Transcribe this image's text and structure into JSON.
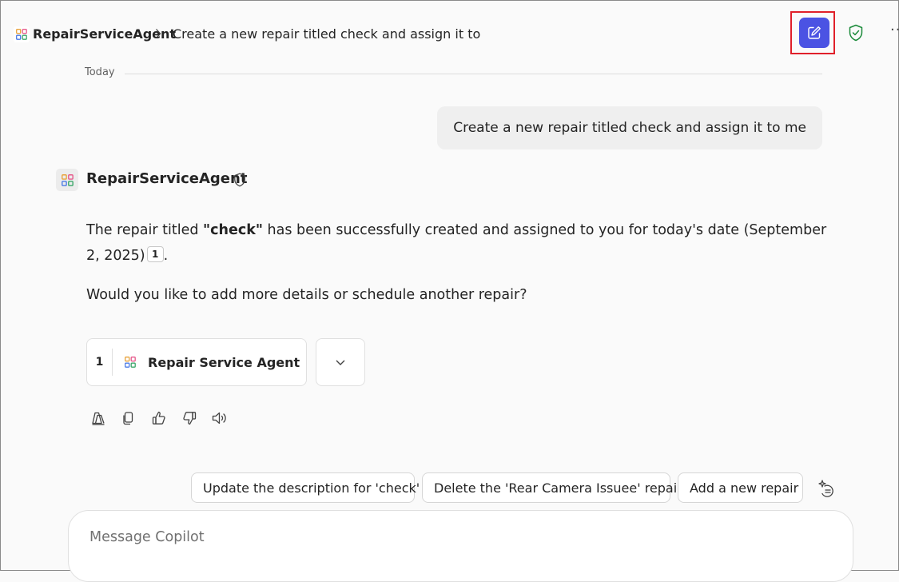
{
  "header": {
    "agent_icon": "agent-app-icon",
    "agent_name": "RepairServiceAgent",
    "conversation_title": "Create a new repair titled check and assign it to",
    "new_chat_icon": "compose-icon",
    "accent_color": "#4b53e3",
    "highlight_color": "#e0202a",
    "shield_color": "#1b8a3a",
    "more_label": "···"
  },
  "chat": {
    "date_label": "Today",
    "user_message": "Create a new repair titled check and assign it to me",
    "response": {
      "agent_name": "RepairServiceAgent",
      "text_before_bold": "The repair titled ",
      "bold_text": "\"check\"",
      "text_after_bold": " has been successfully created and assigned to you for today's date (September 2, 2025)",
      "citation": "1",
      "text_end": ".",
      "question": "Would you like to add more details or schedule another repair?"
    },
    "reference": {
      "number": "1",
      "label": "Repair Service Agent"
    },
    "actions": [
      "notebook-icon",
      "copy-icon",
      "thumbs-up-icon",
      "thumbs-down-icon",
      "speaker-icon"
    ]
  },
  "suggestions": [
    "Update the description for 'check'",
    "Delete the 'Rear Camera Issuee' repair",
    "Add a new repair"
  ],
  "composer": {
    "placeholder": "Message Copilot"
  }
}
